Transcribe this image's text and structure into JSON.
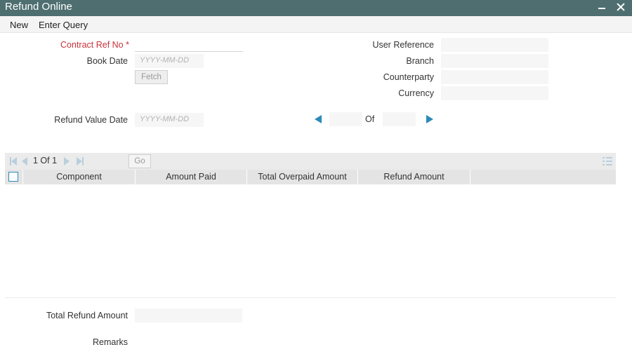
{
  "window": {
    "title": "Refund Online"
  },
  "menu": {
    "new": "New",
    "enter_query": "Enter Query"
  },
  "form": {
    "contract_ref_label": "Contract Ref No",
    "required_marker": "*",
    "book_date_label": "Book Date",
    "book_date_placeholder": "YYYY-MM-DD",
    "fetch_label": "Fetch",
    "user_reference_label": "User Reference",
    "branch_label": "Branch",
    "counterparty_label": "Counterparty",
    "currency_label": "Currency",
    "refund_value_date_label": "Refund Value Date",
    "refund_value_date_placeholder": "YYYY-MM-DD",
    "of_label": "Of"
  },
  "grid": {
    "pagination_text": "1 Of 1",
    "go_label": "Go",
    "columns": [
      "Component",
      "Amount Paid",
      "Total Overpaid Amount",
      "Refund Amount"
    ]
  },
  "footer": {
    "total_refund_label": "Total Refund Amount",
    "remarks_label": "Remarks"
  },
  "colors": {
    "titlebar": "#4e6e70",
    "accent": "#2b8ab8",
    "required": "#c7323c"
  },
  "icons": [
    "minimize-icon",
    "close-icon",
    "prev-record-icon",
    "next-record-icon",
    "first-page-icon",
    "prev-page-icon",
    "next-page-icon",
    "last-page-icon",
    "column-list-icon"
  ]
}
